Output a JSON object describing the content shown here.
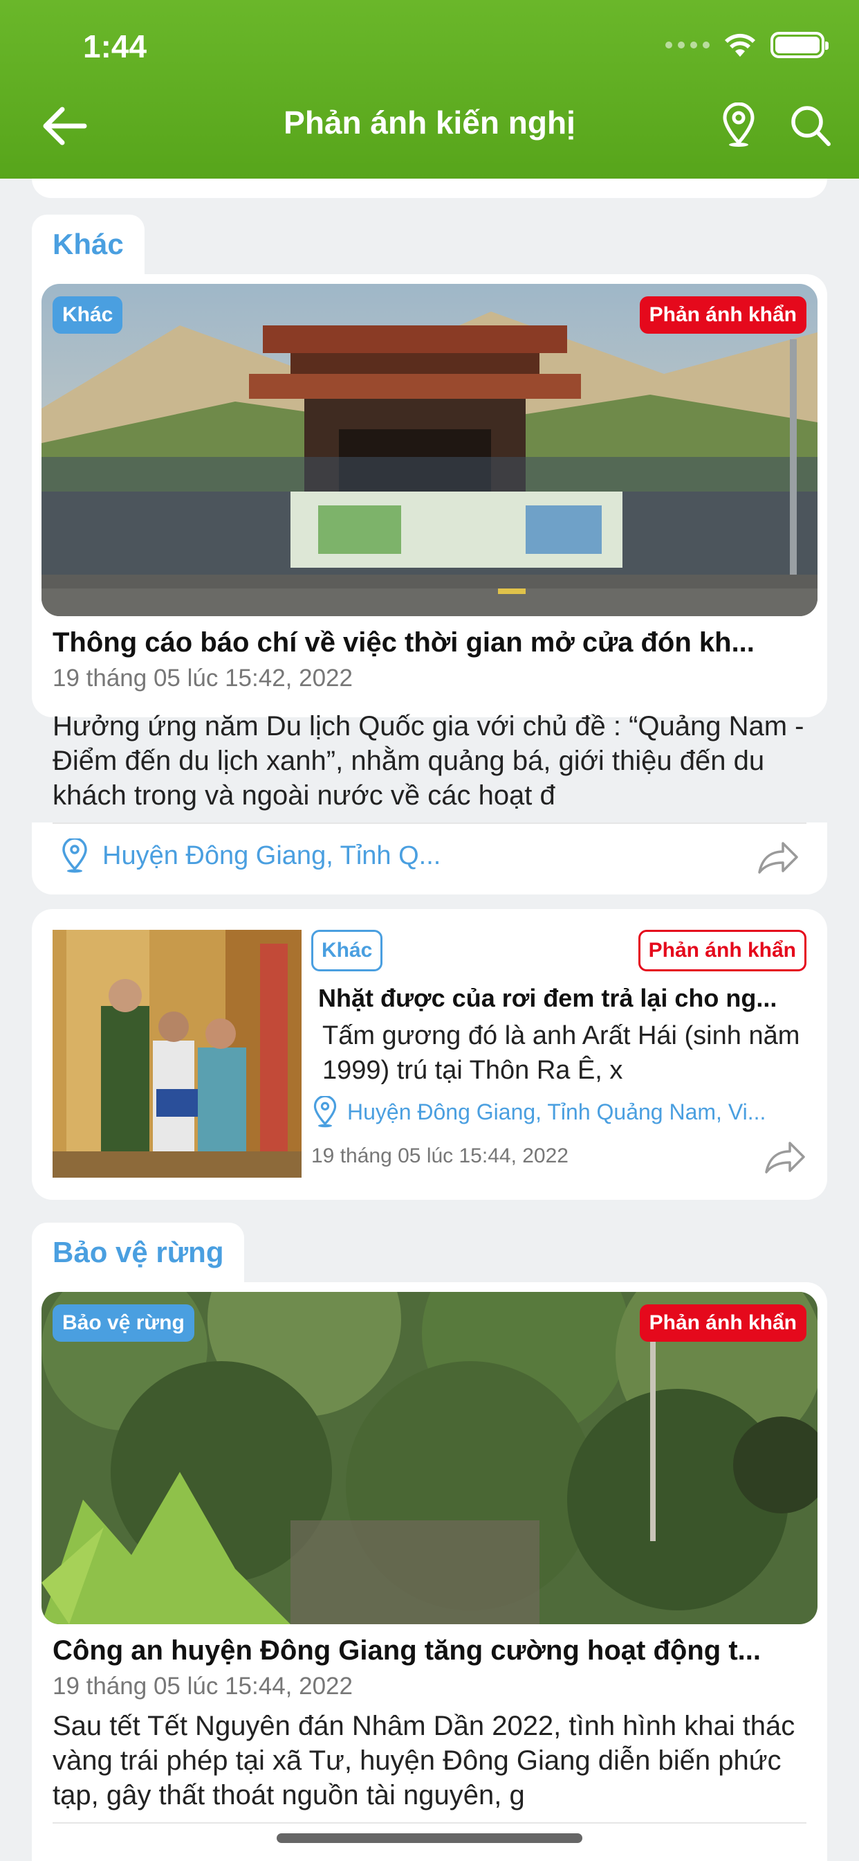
{
  "status_bar": {
    "time": "1:44"
  },
  "header": {
    "title": "Phản ánh kiến nghị"
  },
  "groups": [
    {
      "label": "Khác",
      "featured": {
        "category_badge": "Khác",
        "urgent_badge": "Phản ánh khẩn",
        "title": "Thông cáo báo chí về việc thời gian mở cửa đón kh...",
        "date": "19 tháng 05 lúc 15:42, 2022",
        "body": "Hưởng ứng năm Du lịch Quốc gia với chủ đề : “Quảng Nam - Điểm đến du lịch xanh”, nhằm quảng bá, giới thiệu đến du khách trong và ngoài nước về các hoạt đ",
        "location": "Huyện Đông Giang, Tỉnh Q..."
      },
      "compact": {
        "category_badge": "Khác",
        "urgent_badge": "Phản ánh khẩn",
        "title": "Nhặt được của rơi đem trả lại cho ng...",
        "body": "Tấm gương đó là anh Arất Hái (sinh năm 1999) trú tại Thôn Ra Ê, x",
        "location": "Huyện Đông Giang, Tỉnh Quảng Nam, Vi...",
        "date": "19 tháng 05 lúc 15:44, 2022"
      }
    },
    {
      "label": "Bảo vệ rừng",
      "featured": {
        "category_badge": "Bảo vệ rừng",
        "urgent_badge": "Phản ánh khẩn",
        "title": "Công an huyện Đông Giang tăng cường hoạt động t...",
        "date": "19 tháng 05 lúc 15:44, 2022",
        "body": "Sau tết Tết Nguyên đán Nhâm Dần 2022, tình hình khai thác vàng trái phép tại xã Tư, huyện Đông Giang diễn biến phức tạp, gây thất thoát nguồn tài nguyên, g"
      }
    }
  ],
  "colors": {
    "header": "#5aa81e",
    "accent": "#4a9fe0",
    "urgent": "#e5091c"
  }
}
